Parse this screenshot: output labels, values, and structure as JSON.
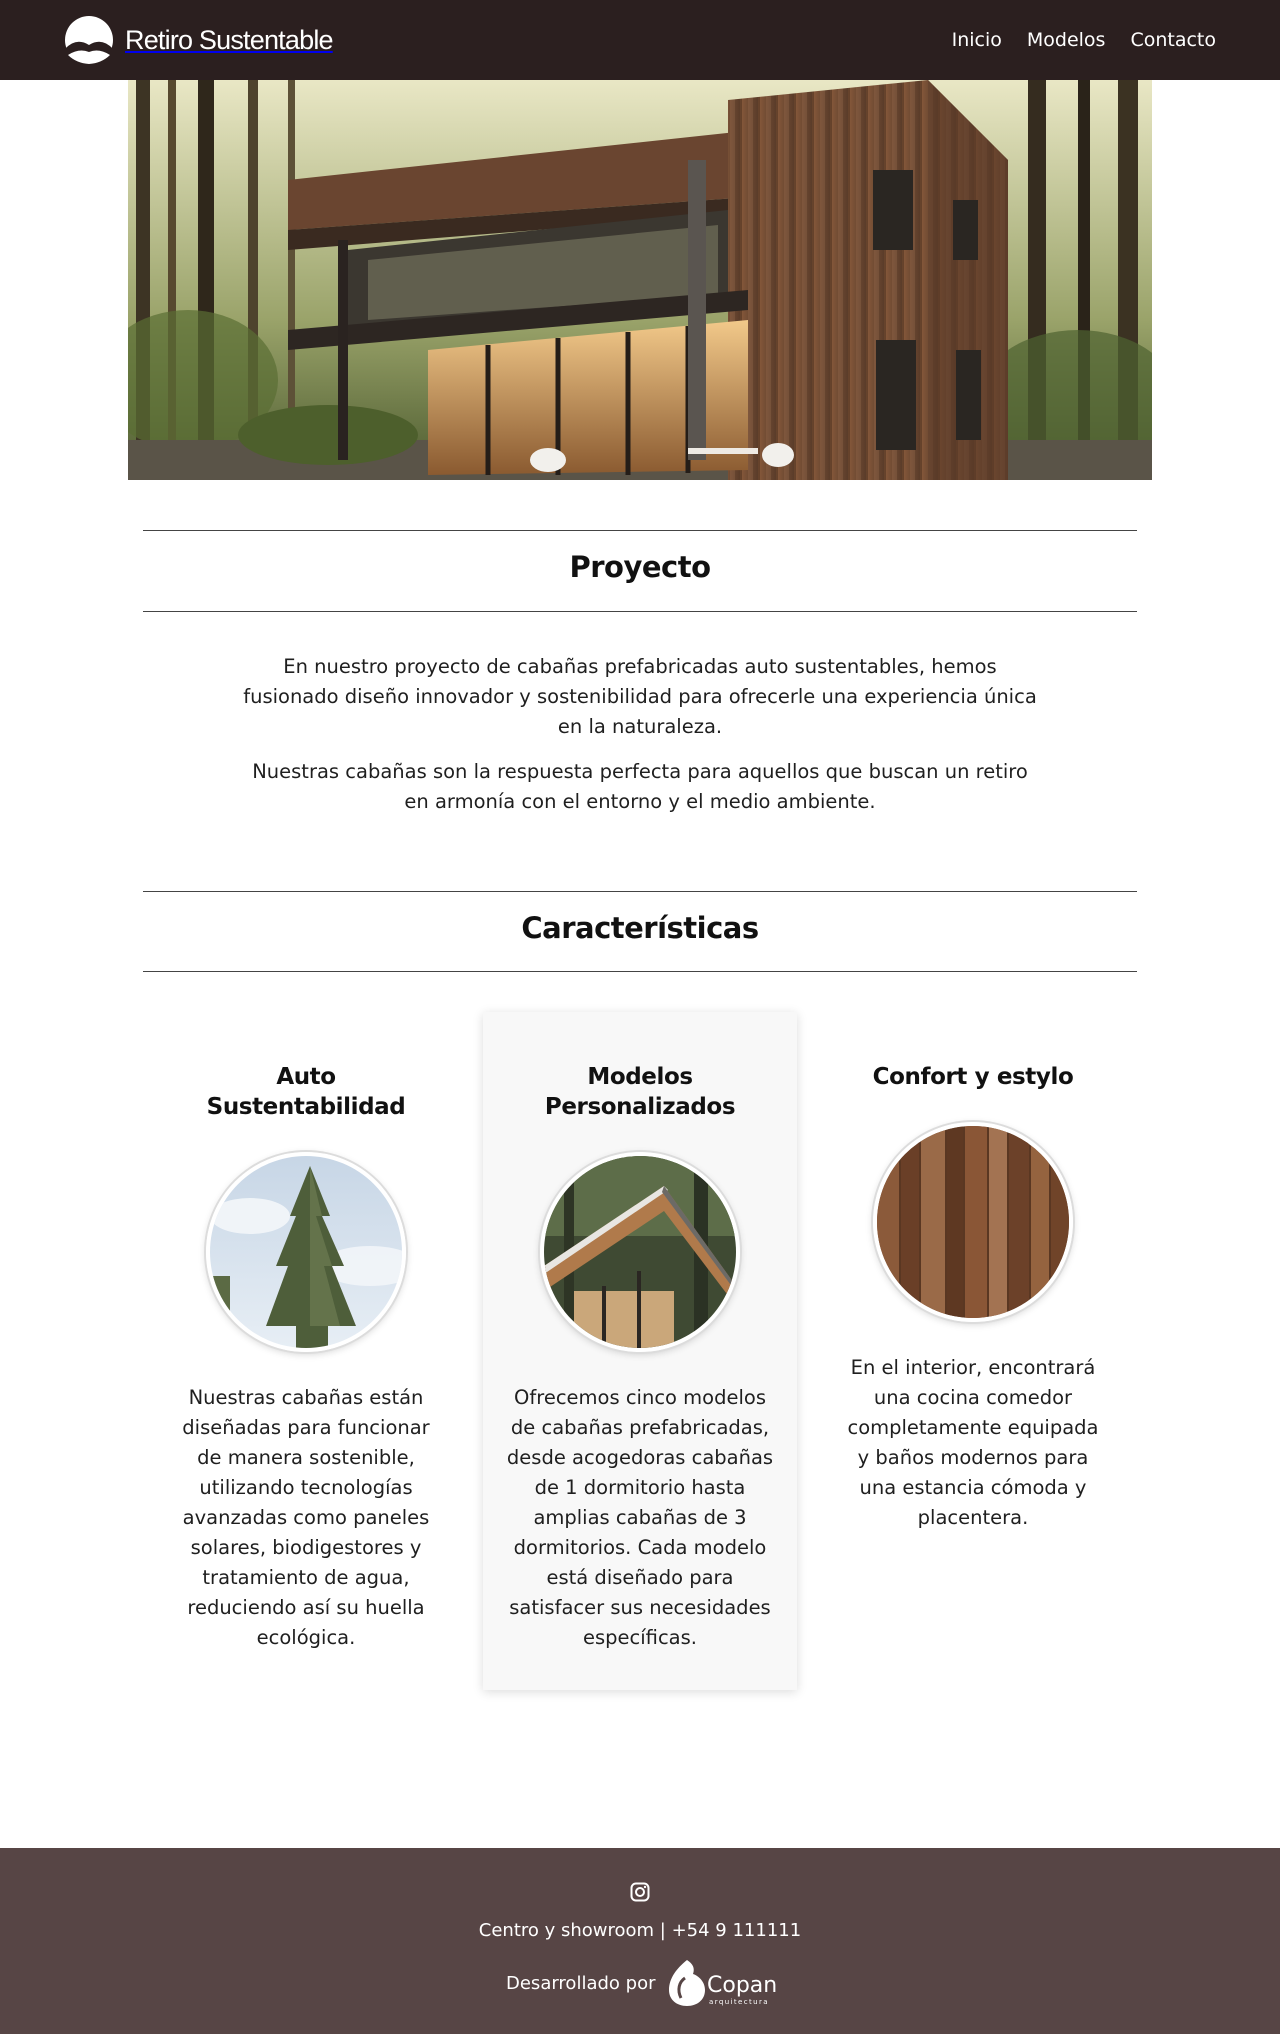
{
  "brand": {
    "name": "Retiro Sustentable",
    "logo_icon": "mountain-logo-icon"
  },
  "nav": {
    "items": [
      "Inicio",
      "Modelos",
      "Contacto"
    ]
  },
  "hero": {
    "image": "wooden-cabin-forest-photo"
  },
  "proyecto": {
    "title": "Proyecto",
    "paragraphs": [
      "En nuestro proyecto de cabañas prefabricadas auto sustentables, hemos fusionado diseño innovador y sostenibilidad para ofrecerle una experiencia única en la naturaleza.",
      "Nuestras cabañas son la respuesta perfecta para aquellos que buscan un retiro en armonía con el entorno y el medio ambiente."
    ]
  },
  "caracteristicas": {
    "title": "Características",
    "cards": [
      {
        "title": "Auto Sustentabilidad",
        "image": "pine-tree-photo",
        "text": "Nuestras cabañas están diseñadas para funcionar de manera sostenible, utilizando tecnologías avanzadas como paneles solares, biodigestores y tratamiento de agua, reduciendo así su huella ecológica."
      },
      {
        "title": "Modelos Personalizados",
        "image": "cabin-roof-photo",
        "text": "Ofrecemos cinco modelos de cabañas prefabricadas, desde acogedoras cabañas de 1 dormitorio hasta amplias cabañas de 3 dormitorios. Cada modelo está diseñado para satisfacer sus necesidades específicas."
      },
      {
        "title": "Confort y estylo",
        "image": "wood-planks-photo",
        "text": "En el interior, encontrará una cocina comedor completamente equipada y baños modernos para una estancia cómoda y placentera."
      }
    ]
  },
  "footer": {
    "social_icon": "instagram-icon",
    "contact": "Centro y showroom | +54 9 111111",
    "credit_label": "Desarrollado por",
    "credit_brand": "Copan",
    "credit_sub": "arquitectura"
  },
  "colors": {
    "navbar": "#2b1f1f",
    "footer": "#574545",
    "featured_card": "#f8f8f8"
  }
}
